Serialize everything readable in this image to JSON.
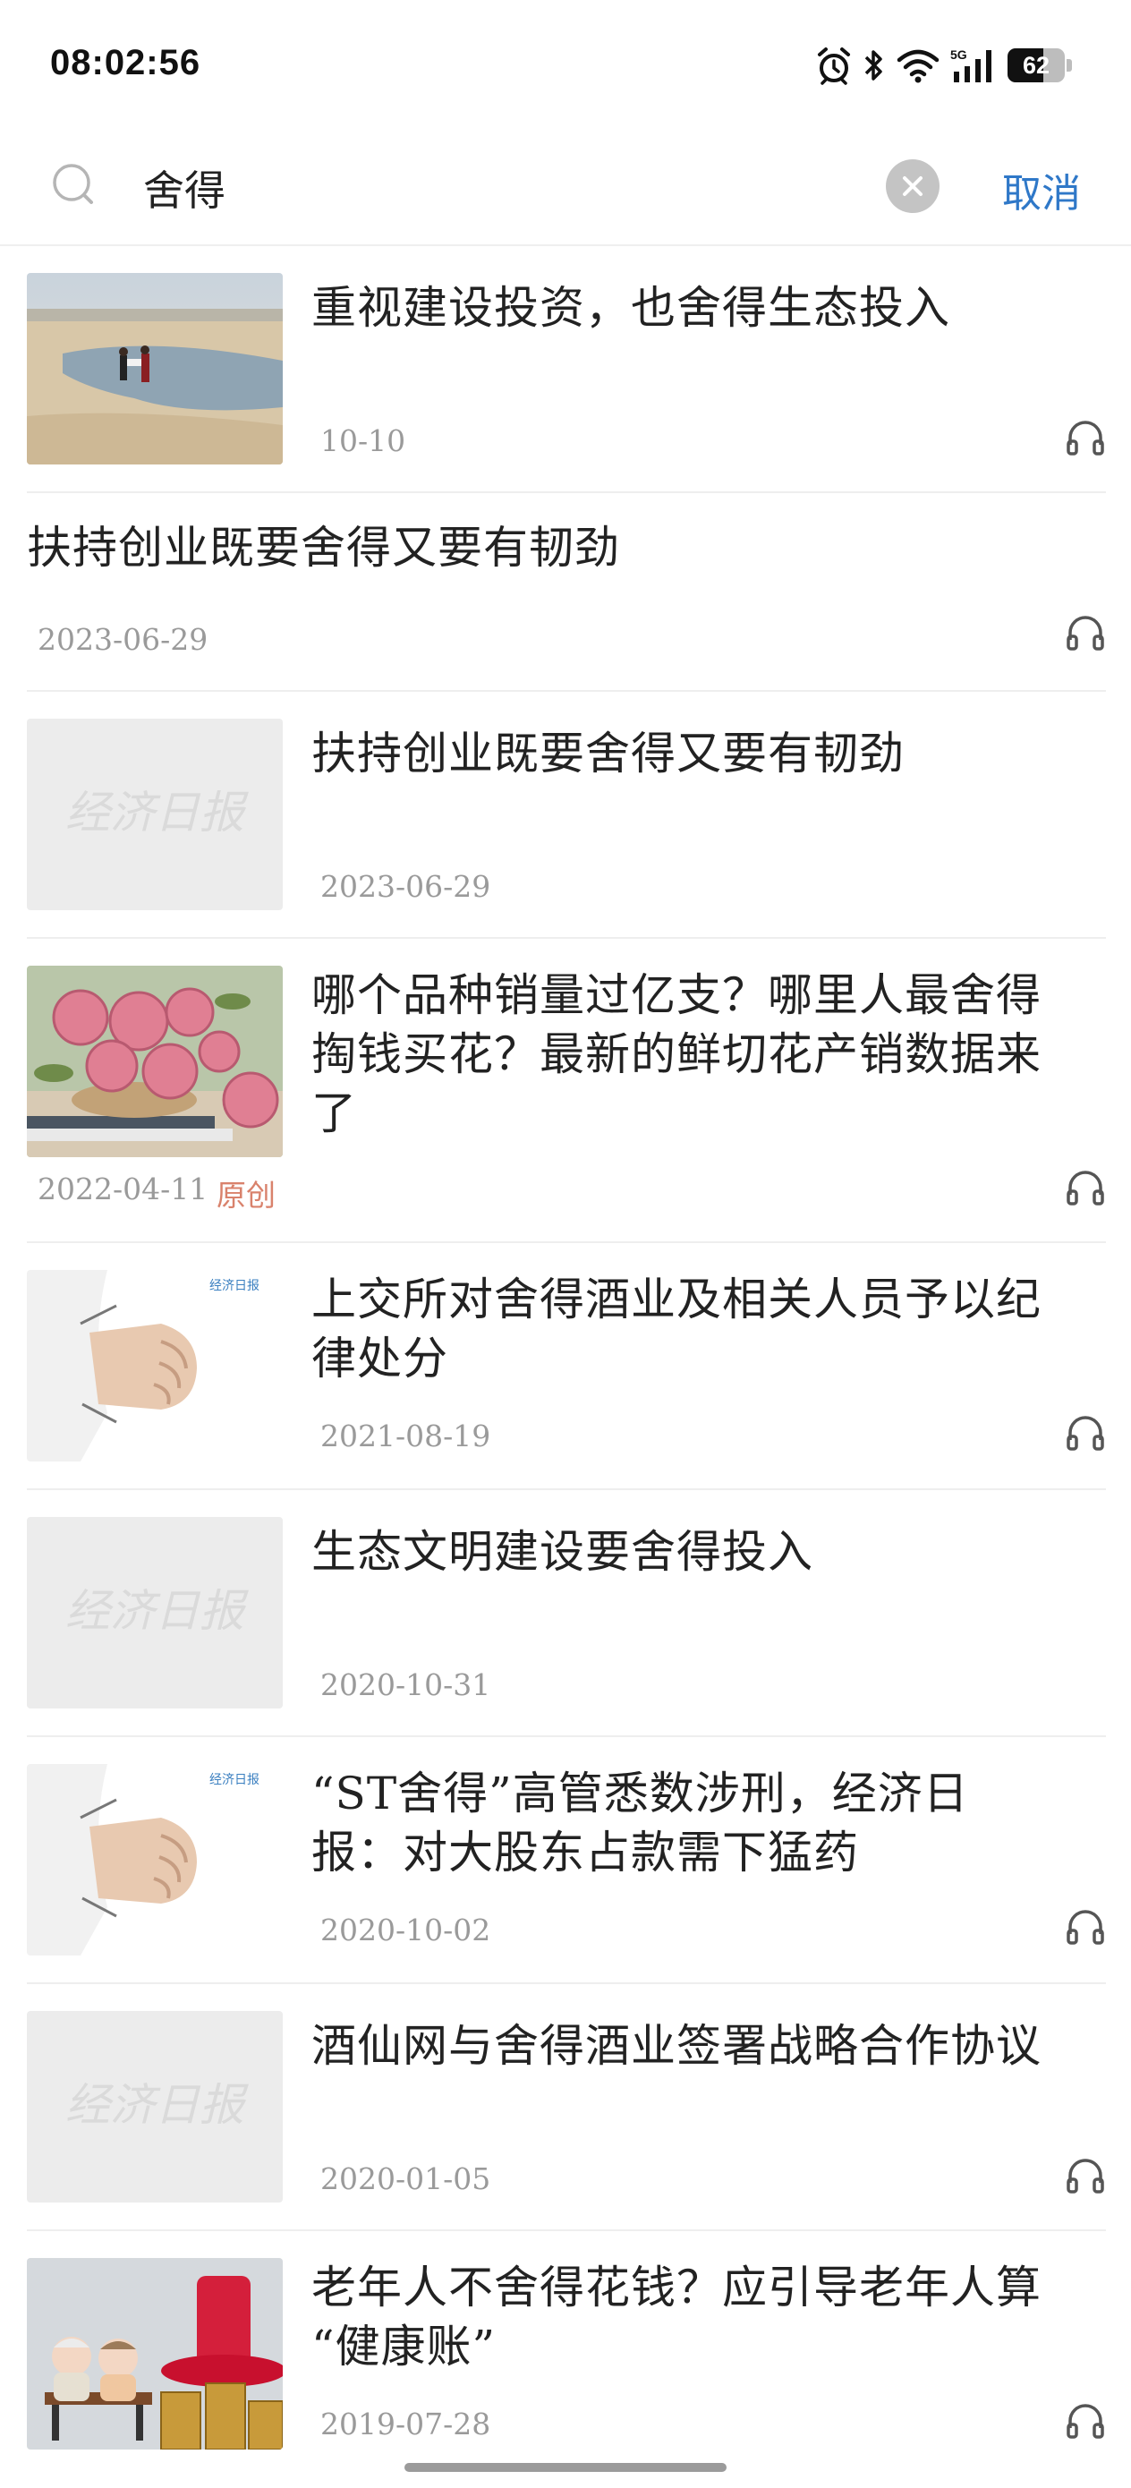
{
  "status_bar": {
    "time": "08:02:56",
    "network": "5G",
    "battery": "62",
    "battery_level": 0.62
  },
  "search": {
    "query": "舍得",
    "cancel_label": "取消"
  },
  "results": [
    {
      "title": "重视建设投资，也舍得生态投入",
      "date": "10-10"
    },
    {
      "title": "扶持创业既要舍得又要有韧劲",
      "date": "2023-06-29"
    },
    {
      "title": "扶持创业既要舍得又要有韧劲",
      "date": "2023-06-29"
    },
    {
      "title_lines": [
        "哪个品种销量过亿支？哪里人最舍得",
        "掏钱买花？最新的鲜切花产销数据来",
        "了"
      ],
      "date": "2022-04-11",
      "tag": "原创"
    },
    {
      "title_lines": [
        "上交所对舍得酒业及相关人员予以纪",
        "律处分"
      ],
      "date": "2021-08-19"
    },
    {
      "title": "生态文明建设要舍得投入",
      "date": "2020-10-31"
    },
    {
      "title_lines": [
        "“ST舍得”高管悉数涉刑，经济日",
        "报：对大股东占款需下猛药"
      ],
      "date": "2020-10-02"
    },
    {
      "title": "酒仙网与舍得酒业签署战略合作协议",
      "date": "2020-01-05"
    },
    {
      "title_lines": [
        "老年人不舍得花钱？应引导老年人算",
        "“健康账”"
      ],
      "date": "2019-07-28"
    }
  ],
  "thumbnails": {
    "placeholder_logo": "经济日报",
    "stamp_logo": "经济日报"
  },
  "colors": {
    "accent": "#2f78c8",
    "tag": "#d9826c",
    "meta": "#9a9a9a"
  }
}
